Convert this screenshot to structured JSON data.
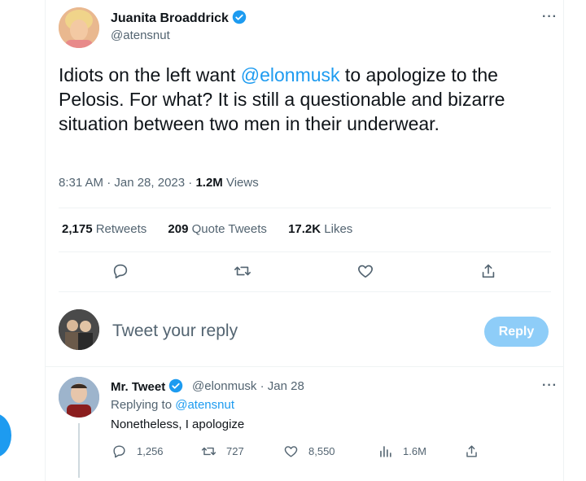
{
  "tweet": {
    "author_name": "Juanita Broaddrick",
    "author_handle": "@atensnut",
    "text_before": "Idiots on the left want ",
    "mention": "@elonmusk",
    "text_after": " to apologize to the Pelosis.  For what?   It is still a questionable and bizarre situation between two men in their underwear.",
    "time": "8:31 AM · Jan 28, 2023 · ",
    "views_count": "1.2M",
    "views_label": " Views",
    "more_icon": "more-icon",
    "stats": {
      "retweets_count": "2,175",
      "retweets_label": " Retweets",
      "quotes_count": "209",
      "quotes_label": " Quote Tweets",
      "likes_count": "17.2K",
      "likes_label": " Likes"
    }
  },
  "composer": {
    "placeholder": "Tweet your reply",
    "reply_button": "Reply"
  },
  "reply": {
    "name": "Mr. Tweet",
    "handle_date": "@elonmusk · Jan 28",
    "replying_prefix": "Replying to ",
    "replying_handle": "@atensnut",
    "text": "Nonetheless, I apologize",
    "replies": "1,256",
    "retweets": "727",
    "likes": "8,550",
    "views": "1.6M"
  },
  "colors": {
    "accent": "#1d9bf0",
    "secondary_text": "#536471",
    "reply_button_disabled": "#8ecdf8"
  }
}
